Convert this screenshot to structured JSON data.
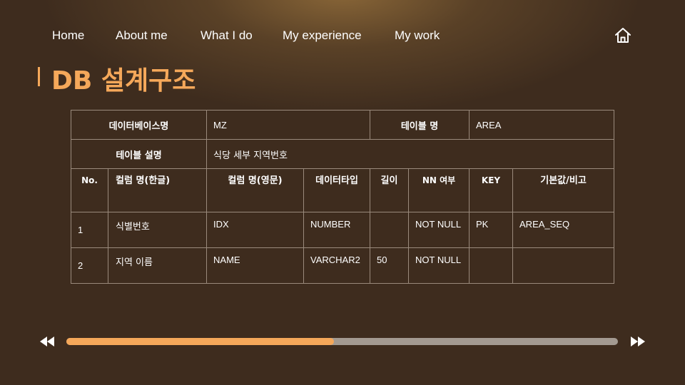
{
  "nav": {
    "items": [
      {
        "label": "Home"
      },
      {
        "label": "About me"
      },
      {
        "label": "What I do"
      },
      {
        "label": "My experience"
      },
      {
        "label": "My work"
      }
    ],
    "home_icon": "home-icon"
  },
  "page": {
    "title": "DB 설계구조"
  },
  "table": {
    "db_name_label": "데이터베이스명",
    "db_name_value": "MZ",
    "table_name_label": "테이블 명",
    "table_name_value": "AREA",
    "table_desc_label": "테이블 설명",
    "table_desc_value": "식당 세부 지역번호",
    "columns": [
      "No.",
      "컬럼 명(한글)",
      "컬럼 명(영문)",
      "데이터타입",
      "길이",
      "NN 여부",
      "KEY",
      "기본값/비고"
    ],
    "rows": [
      {
        "no": "1",
        "name_ko": "식별번호",
        "name_en": "IDX",
        "type": "NUMBER",
        "length": "",
        "nn": "NOT NULL",
        "key": "PK",
        "note": "AREA_SEQ"
      },
      {
        "no": "2",
        "name_ko": "지역 이름",
        "name_en": "NAME",
        "type": "VARCHAR2",
        "length": "50",
        "nn": "NOT NULL",
        "key": "",
        "note": ""
      }
    ]
  },
  "player": {
    "progress": 0.485,
    "rewind_icon": "rewind-icon",
    "forward_icon": "fast-forward-icon"
  },
  "colors": {
    "accent": "#f5a85a",
    "background": "#3e2c1e",
    "track": "#a39a91",
    "border": "#9a8a7c"
  }
}
